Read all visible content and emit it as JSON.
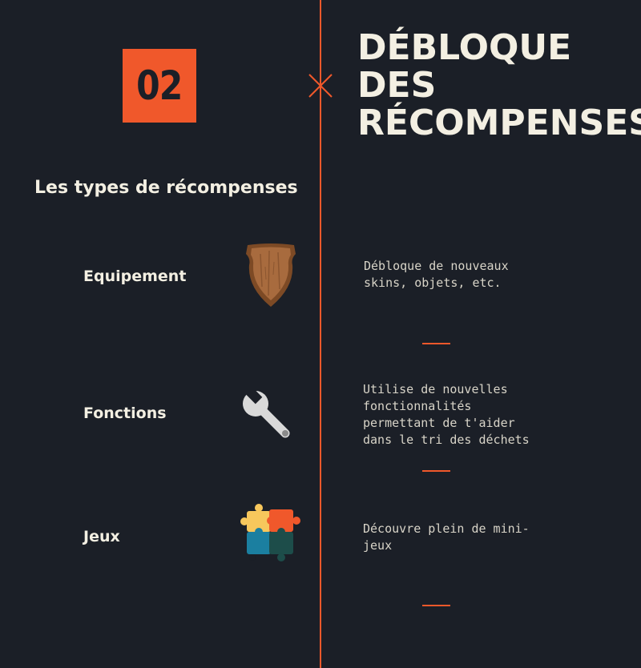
{
  "badge": {
    "number": "02"
  },
  "title": {
    "lines": [
      "DÉBLOQUE",
      "DES",
      "RÉCOMPENSES"
    ]
  },
  "subtitle": "Les types de récompenses",
  "rewards": [
    {
      "label": "Equipement",
      "icon": "shield-icon",
      "description": "Débloque de nouveaux skins, objets, etc."
    },
    {
      "label": "Fonctions",
      "icon": "wrench-icon",
      "description": "Utilise de nouvelles fonctionnalités permettant de t'aider dans le tri des déchets"
    },
    {
      "label": "Jeux",
      "icon": "puzzle-icon",
      "description": "Découvre plein de mini-jeux"
    }
  ],
  "colors": {
    "background": "#1b1f27",
    "accent": "#f0582b",
    "text": "#f3efe2"
  }
}
